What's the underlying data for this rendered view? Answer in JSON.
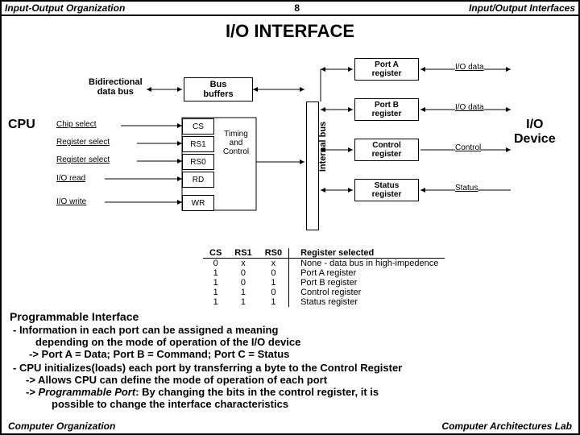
{
  "header": {
    "left": "Input-Output Organization",
    "mid": "8",
    "right": "Input/Output Interfaces"
  },
  "title": "I/O  INTERFACE",
  "labels": {
    "cpu": "CPU",
    "bidir1": "Bidirectional",
    "bidir2": "data bus",
    "busbuf1": "Bus",
    "busbuf2": "buffers",
    "sig_cs": "Chip select",
    "sig_rs1": "Register select",
    "sig_rs0": "Register select",
    "sig_rd": "I/O read",
    "sig_wr": "I/O write",
    "box_cs": "CS",
    "box_rs1": "RS1",
    "box_rs0": "RS0",
    "box_rd": "RD",
    "box_wr": "WR",
    "tac1": "Timing",
    "tac2": "and",
    "tac3": "Control",
    "internal": "Internal bus",
    "reg_a1": "Port A",
    "reg_a2": "register",
    "reg_b1": "Port B",
    "reg_b2": "register",
    "reg_c1": "Control",
    "reg_c2": "register",
    "reg_s1": "Status",
    "reg_s2": "register",
    "io_a": "I/O data",
    "io_b": "I/O data",
    "io_c": "Control",
    "io_s": "Status",
    "iodev1": "I/O",
    "iodev2": "Device"
  },
  "table": {
    "headers": [
      "CS",
      "RS1",
      "RS0",
      "Register selected"
    ],
    "rows": [
      [
        "0",
        "x",
        "x",
        "None - data bus in high-impedence"
      ],
      [
        "1",
        "0",
        "0",
        "Port A register"
      ],
      [
        "1",
        "0",
        "1",
        "Port B register"
      ],
      [
        "1",
        "1",
        "0",
        "Control register"
      ],
      [
        "1",
        "1",
        "1",
        "Status register"
      ]
    ]
  },
  "progif": "Programmable Interface",
  "bullets": {
    "b1a": "- Information in each port can be assigned a meaning",
    "b1b": "depending on the mode of operation of the I/O device",
    "b1c": "-> Port A = Data; Port B = Command;  Port C = Status",
    "b2a": "- CPU initializes(loads) each port by transferring a byte to the Control Register",
    "b2b": "-> Allows CPU can define the mode of operation of each port",
    "b2c1": "-> ",
    "b2c2": "Programmable Port",
    "b2c3": ": By changing the bits in the control register, it is",
    "b2d": "possible to change the interface characteristics"
  },
  "footer": {
    "left": "Computer Organization",
    "right": "Computer Architectures Lab"
  }
}
